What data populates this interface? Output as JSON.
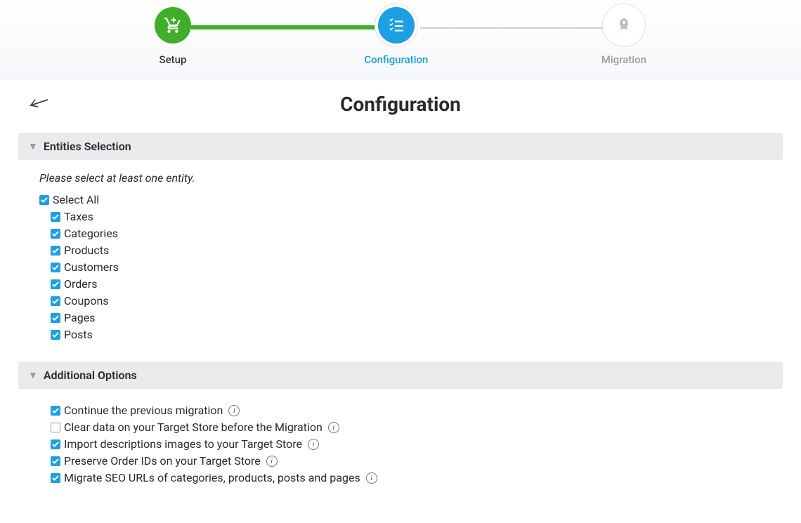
{
  "stepper": {
    "steps": [
      {
        "label": "Setup",
        "state": "done"
      },
      {
        "label": "Configuration",
        "state": "active"
      },
      {
        "label": "Migration",
        "state": "pending"
      }
    ]
  },
  "page": {
    "title": "Configuration"
  },
  "sections": {
    "entities": {
      "title": "Entities Selection",
      "hint": "Please select at least one entity.",
      "selectAllLabel": "Select All",
      "selectAllChecked": true,
      "items": [
        {
          "label": "Taxes",
          "checked": true
        },
        {
          "label": "Categories",
          "checked": true
        },
        {
          "label": "Products",
          "checked": true
        },
        {
          "label": "Customers",
          "checked": true
        },
        {
          "label": "Orders",
          "checked": true
        },
        {
          "label": "Coupons",
          "checked": true
        },
        {
          "label": "Pages",
          "checked": true
        },
        {
          "label": "Posts",
          "checked": true
        }
      ]
    },
    "options": {
      "title": "Additional Options",
      "items": [
        {
          "label": "Continue the previous migration",
          "checked": true,
          "info": true
        },
        {
          "label": "Clear data on your Target Store before the Migration",
          "checked": false,
          "info": true
        },
        {
          "label": "Import descriptions images to your Target Store",
          "checked": true,
          "info": true
        },
        {
          "label": "Preserve Order IDs on your Target Store",
          "checked": true,
          "info": true
        },
        {
          "label": "Migrate SEO URLs of categories, products, posts and pages",
          "checked": true,
          "info": true
        }
      ]
    }
  }
}
